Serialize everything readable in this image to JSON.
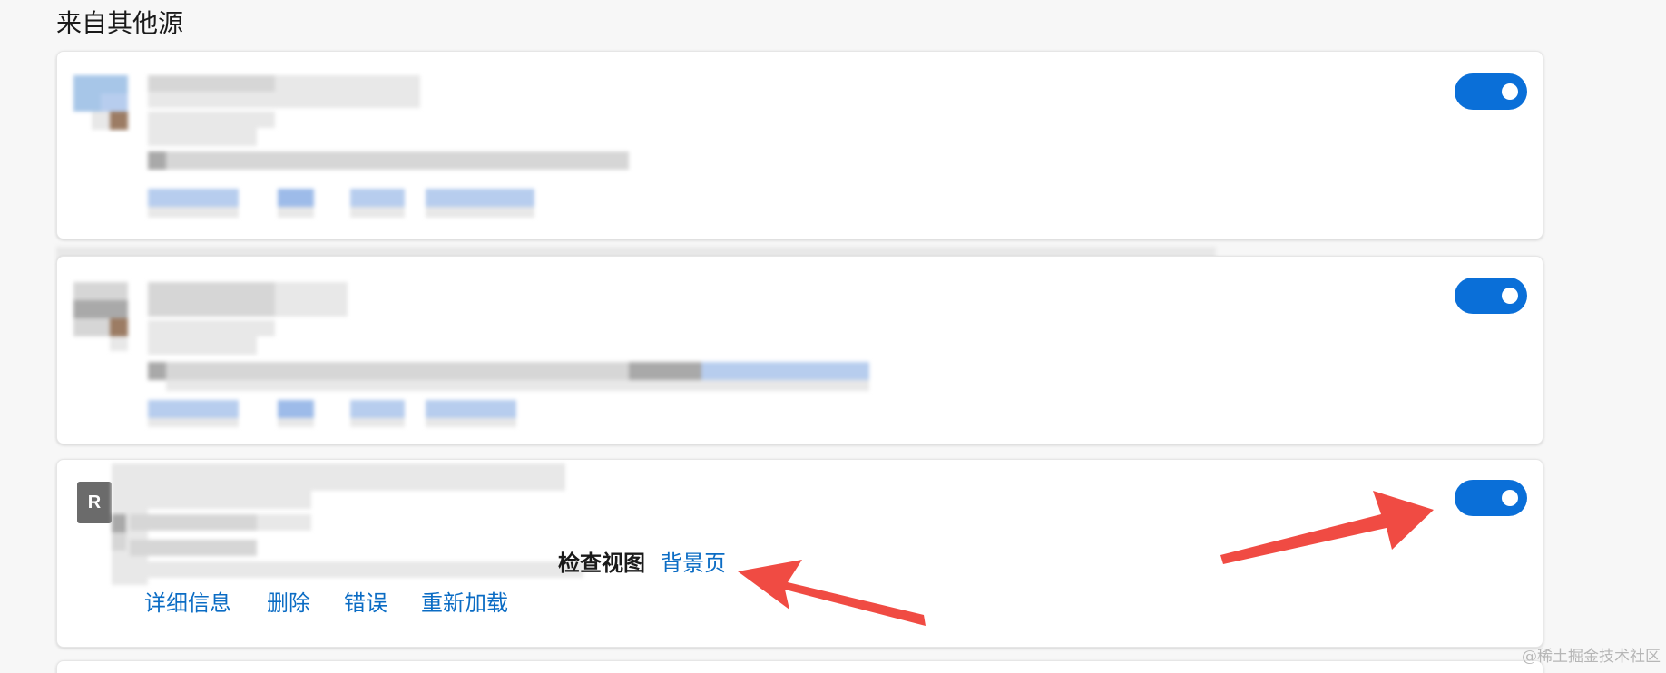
{
  "section": {
    "title": "来自其他源"
  },
  "extension_card_3": {
    "avatar_letter": "R",
    "inspect_views_label": "检查视图",
    "background_page_link": "背景页",
    "actions": [
      {
        "label": "详细信息"
      },
      {
        "label": "删除"
      },
      {
        "label": "错误"
      },
      {
        "label": "重新加载"
      }
    ]
  },
  "toggles": [
    {
      "state": "on"
    },
    {
      "state": "on"
    },
    {
      "state": "on"
    }
  ],
  "colors": {
    "toggle_on": "#0a6fd8",
    "link": "#0b6cc4",
    "arrow": "#f04b43"
  },
  "watermark": "@稀土掘金技术社区"
}
